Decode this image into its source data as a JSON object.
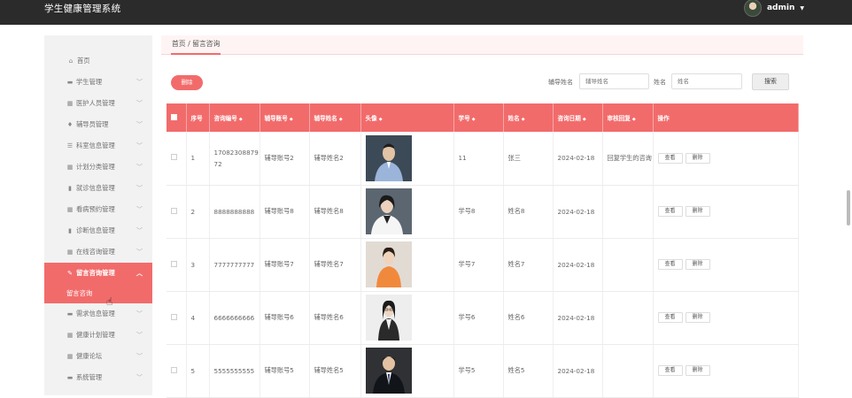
{
  "app": {
    "title": "学生健康管理系统",
    "user": "admin"
  },
  "sidebar": {
    "home": "首页",
    "items": [
      {
        "label": "学生管理",
        "icon": "user-card-icon"
      },
      {
        "label": "医护人员管理",
        "icon": "grid-icon"
      },
      {
        "label": "辅导员管理",
        "icon": "pin-icon"
      },
      {
        "label": "科室信息管理",
        "icon": "list-icon"
      },
      {
        "label": "计划分类管理",
        "icon": "grid-icon"
      },
      {
        "label": "就诊信息管理",
        "icon": "clipboard-icon"
      },
      {
        "label": "看病预约管理",
        "icon": "grid-icon"
      },
      {
        "label": "诊断信息管理",
        "icon": "clipboard-icon"
      },
      {
        "label": "在线咨询管理",
        "icon": "grid-icon"
      }
    ],
    "active": {
      "label": "留言咨询管理",
      "sub": "留言咨询"
    },
    "items_after": [
      {
        "label": "需求信息管理",
        "icon": "message-icon"
      },
      {
        "label": "健康计划管理",
        "icon": "grid-icon"
      },
      {
        "label": "健康论坛",
        "icon": "grid-icon"
      },
      {
        "label": "系统管理",
        "icon": "message-icon"
      }
    ]
  },
  "breadcrumb": "首页 / 留言咨询",
  "toolbar": {
    "delete_label": "删除",
    "tutor_name_label": "辅导姓名",
    "tutor_name_placeholder": "辅导姓名",
    "name_label": "姓名",
    "name_placeholder": "姓名",
    "search_label": "搜索"
  },
  "table": {
    "headers": [
      "序号",
      "咨询编号",
      "辅导账号",
      "辅导姓名",
      "头像",
      "学号",
      "姓名",
      "咨询日期",
      "审核回复",
      "操作"
    ],
    "view_label": "查看",
    "delete_label": "删除",
    "rows": [
      {
        "idx": "1",
        "code": "1708230887972",
        "account": "辅导账号2",
        "tutor": "辅导姓名2",
        "sid": "11",
        "name": "张三",
        "date": "2024-02-18",
        "reply": "回复学生的咨询",
        "photo": "man-blue-shirt"
      },
      {
        "idx": "2",
        "code": "8888888888",
        "account": "辅导账号8",
        "tutor": "辅导姓名8",
        "sid": "学号8",
        "name": "姓名8",
        "date": "2024-02-18",
        "reply": "",
        "photo": "woman-white-blazer"
      },
      {
        "idx": "3",
        "code": "7777777777",
        "account": "辅导账号7",
        "tutor": "辅导姓名7",
        "sid": "学号7",
        "name": "姓名7",
        "date": "2024-02-18",
        "reply": "",
        "photo": "woman-orange-top"
      },
      {
        "idx": "4",
        "code": "6666666666",
        "account": "辅导账号6",
        "tutor": "辅导姓名6",
        "sid": "学号6",
        "name": "姓名6",
        "date": "2024-02-18",
        "reply": "",
        "photo": "woman-glasses-dark"
      },
      {
        "idx": "5",
        "code": "5555555555",
        "account": "辅导账号5",
        "tutor": "辅导姓名5",
        "sid": "学号5",
        "name": "姓名5",
        "date": "2024-02-18",
        "reply": "",
        "photo": "man-dark-suit"
      }
    ]
  }
}
